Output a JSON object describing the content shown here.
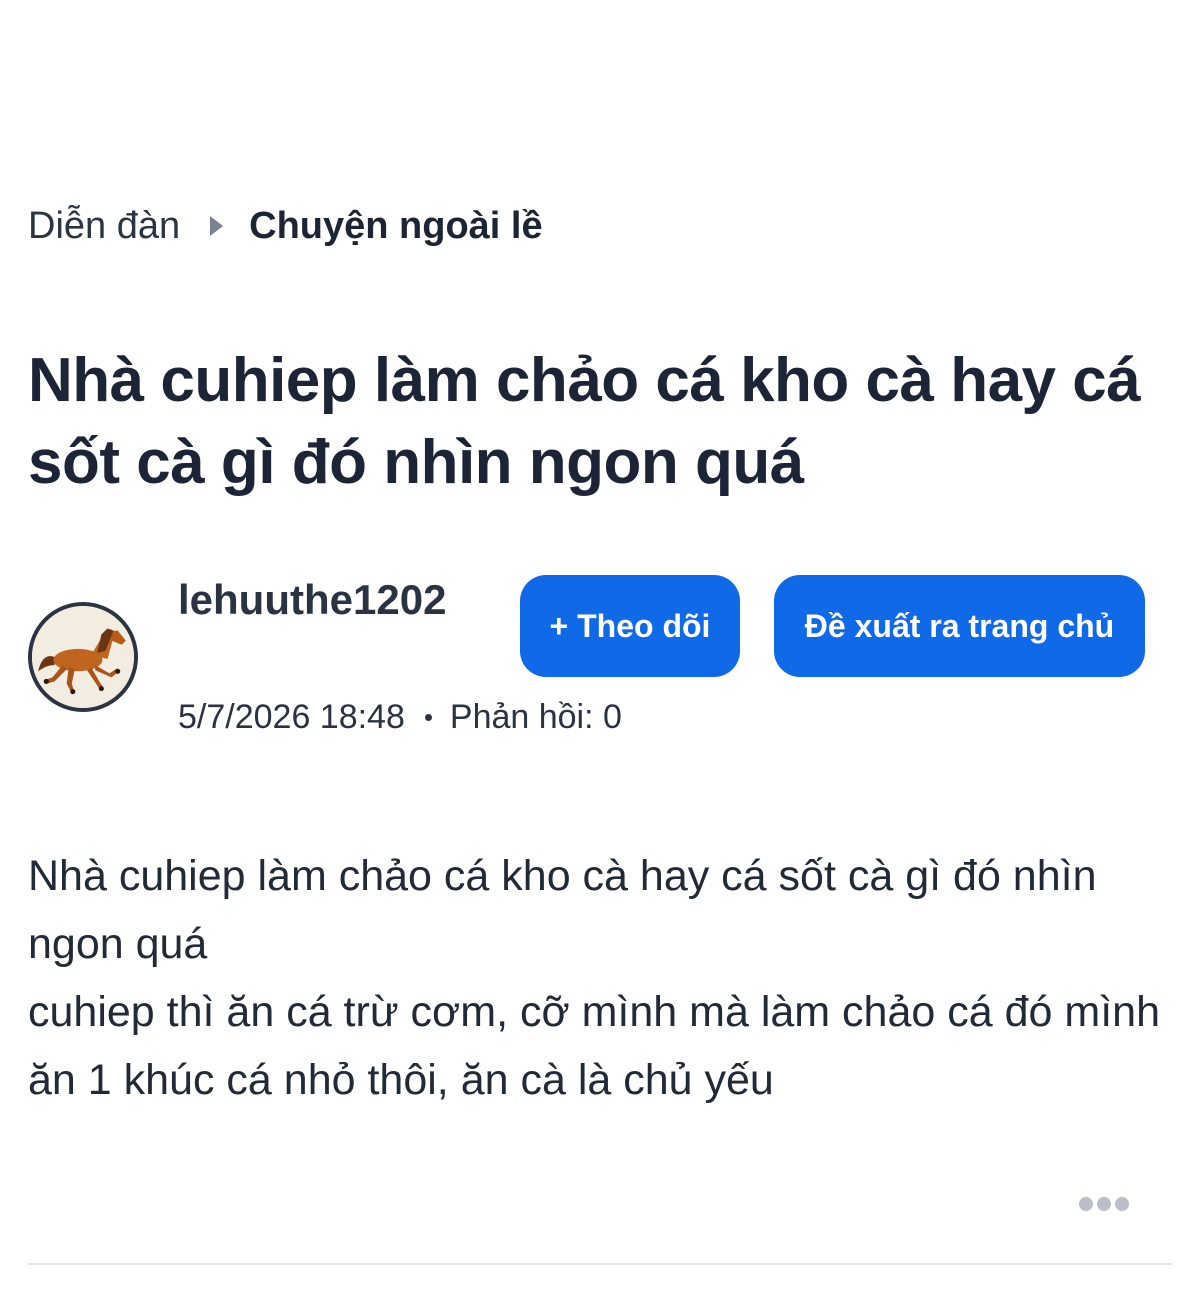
{
  "breadcrumb": {
    "home": "Diễn đàn",
    "current": "Chuyện ngoài lề"
  },
  "post": {
    "title": "Nhà cuhiep làm chảo cá kho cà hay cá sốt cà gì đó nhìn ngon quá",
    "author": "lehuuthe1202",
    "date": "5/7/2026 18:48",
    "replies": "Phản hồi: 0",
    "body": [
      "Nhà cuhiep làm chảo cá kho cà hay cá sốt cà gì đó nhìn ngon quá",
      "cuhiep thì ăn cá trừ cơm, cỡ mình mà làm chảo cá đó mình ăn 1 khúc cá nhỏ thôi, ăn cà là chủ yếu"
    ]
  },
  "actions": {
    "follow_label": "+ Theo dõi",
    "suggest_label": "Đề xuất ra trang chủ"
  },
  "icons": {
    "avatar": "horse-icon",
    "breadcrumb_separator": "triangle-right-icon",
    "more": "more-dots-icon"
  },
  "colors": {
    "accent": "#1069e6",
    "text": "#1d2433"
  }
}
